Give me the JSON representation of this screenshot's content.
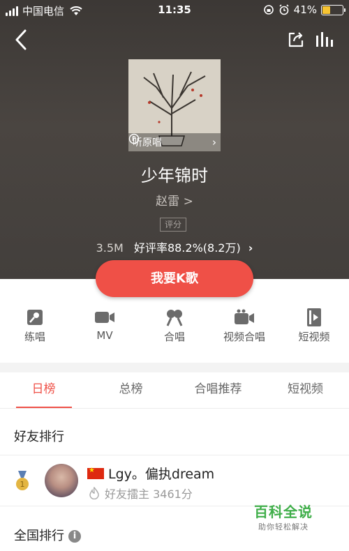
{
  "status_bar": {
    "carrier": "中国电信",
    "time": "11:35",
    "battery": "41%",
    "battery_level": 0.41
  },
  "nav": {
    "back_icon": "chevron-left-icon",
    "share_icon": "share-icon",
    "chart_icon": "bar-chart-icon"
  },
  "song": {
    "cover_label": "听原唱",
    "title": "少年锦时",
    "singer": "赵雷 >",
    "rating_tag": "评分",
    "plays": "3.5M",
    "rating_text": "好评率88.2%(8.2万)"
  },
  "primary_button": "我要K歌",
  "actions": [
    {
      "label": "练唱",
      "icon": "practice-icon"
    },
    {
      "label": "MV",
      "icon": "video-camera-icon"
    },
    {
      "label": "合唱",
      "icon": "duet-icon"
    },
    {
      "label": "视频合唱",
      "icon": "video-duet-icon"
    },
    {
      "label": "短视频",
      "icon": "short-video-icon"
    }
  ],
  "tabs": [
    {
      "label": "日榜",
      "active": true
    },
    {
      "label": "总榜",
      "active": false
    },
    {
      "label": "合唱推荐",
      "active": false
    },
    {
      "label": "短视频",
      "active": false
    }
  ],
  "friends_ranking": {
    "title": "好友排行",
    "entries": [
      {
        "rank": "1",
        "name": "Lgy。偏执dream",
        "sub": "好友擂主 3461分"
      }
    ]
  },
  "national_ranking": {
    "title": "全国排行",
    "info_icon": "info-icon"
  },
  "watermark": {
    "title": "百科全说",
    "subtitle": "助你轻松解决"
  },
  "colors": {
    "accent": "#ef5047",
    "hero_bg": "#433f3c",
    "watermark_green": "#3fae49"
  }
}
